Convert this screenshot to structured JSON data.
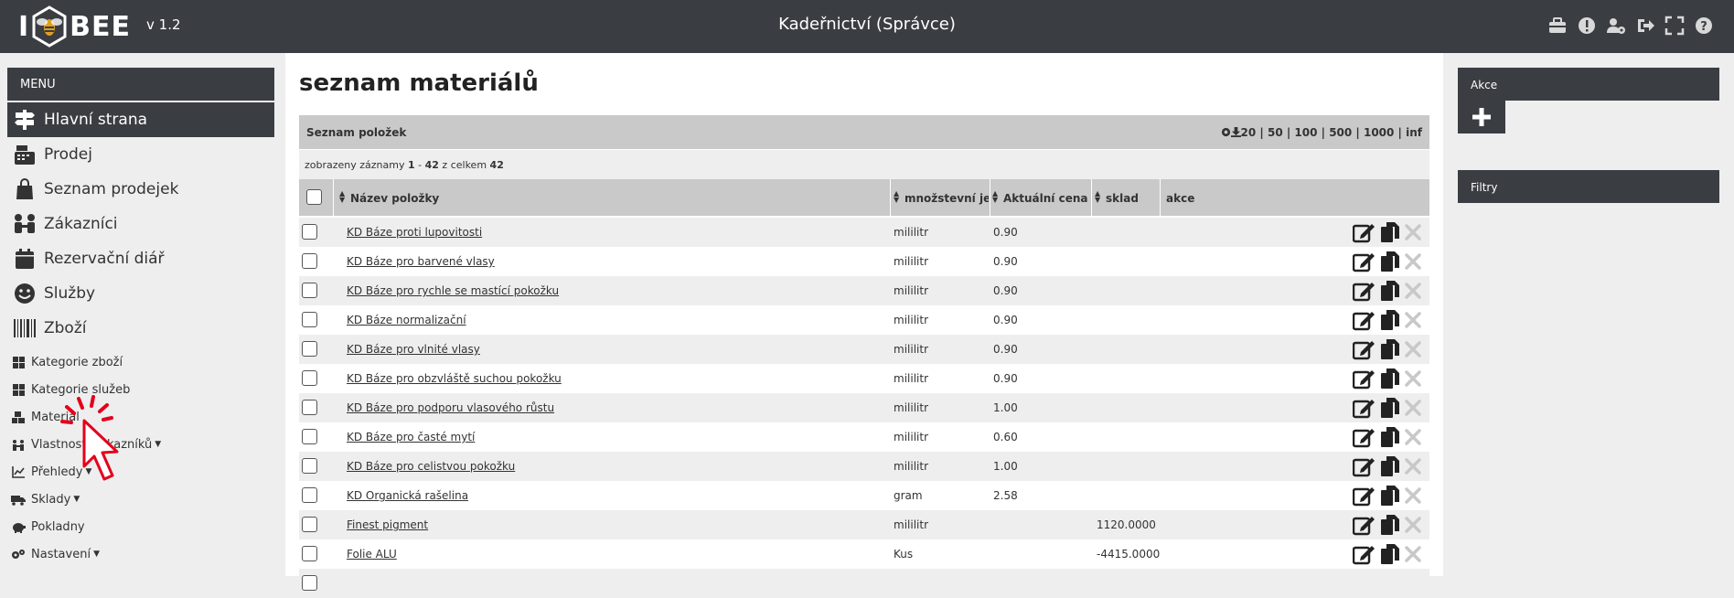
{
  "header": {
    "logo_text_left": "I",
    "logo_text_right": "BEE",
    "version": "v 1.2",
    "title": "Kadeřnictví (Správce)",
    "icons": [
      "briefcase-icon",
      "alert-icon",
      "user-gear-icon",
      "logout-icon",
      "fullscreen-icon",
      "help-icon"
    ]
  },
  "sidebar": {
    "menu_label": "MENU",
    "main_items": [
      {
        "label": "Hlavní strana",
        "icon": "signpost-icon"
      },
      {
        "label": "Prodej",
        "icon": "cash-register-icon"
      },
      {
        "label": "Seznam prodejek",
        "icon": "shopping-bag-icon"
      },
      {
        "label": "Zákazníci",
        "icon": "people-icon"
      },
      {
        "label": "Rezervační diář",
        "icon": "calendar-icon"
      },
      {
        "label": "Služby",
        "icon": "smile-icon"
      },
      {
        "label": "Zboží",
        "icon": "barcode-icon"
      }
    ],
    "sub_items": [
      {
        "label": "Kategorie zboží",
        "icon": "grid-icon"
      },
      {
        "label": "Kategorie služeb",
        "icon": "grid-icon"
      },
      {
        "label": "Materiál",
        "icon": "boxes-icon"
      },
      {
        "label": "Vlastnosti zákazníků",
        "icon": "people-icon"
      },
      {
        "label": "Přehledy",
        "icon": "chart-icon"
      },
      {
        "label": "Sklady",
        "icon": "truck-icon"
      },
      {
        "label": "Pokladny",
        "icon": "piggy-bank-icon"
      },
      {
        "label": "Nastavení",
        "icon": "gears-icon"
      }
    ]
  },
  "main": {
    "title": "seznam materiálů",
    "panel_title": "Seznam položek",
    "page_sizes": "20 | 50 | 100 | 500 | 1000 | inf",
    "records_prefix": "zobrazeny záznamy ",
    "records_from": "1",
    "records_sep": " - ",
    "records_to": "42",
    "records_mid": " z celkem ",
    "records_total": "42",
    "columns": {
      "name": "Název položky",
      "unit": "množstevní jednotk",
      "price": "Aktuální cena",
      "stock": "sklad",
      "actions": "akce"
    },
    "rows": [
      {
        "name": "KD Báze proti lupovitosti",
        "unit": "mililitr",
        "price": "0.90",
        "stock": ""
      },
      {
        "name": "KD Báze pro barvené vlasy",
        "unit": "mililitr",
        "price": "0.90",
        "stock": ""
      },
      {
        "name": "KD Báze pro rychle se mastící pokožku",
        "unit": "mililitr",
        "price": "0.90",
        "stock": ""
      },
      {
        "name": "KD Báze normalizační",
        "unit": "mililitr",
        "price": "0.90",
        "stock": ""
      },
      {
        "name": "KD Báze pro vlnité vlasy",
        "unit": "mililitr",
        "price": "0.90",
        "stock": ""
      },
      {
        "name": "KD Báze pro obzvláště suchou pokožku",
        "unit": "mililitr",
        "price": "0.90",
        "stock": ""
      },
      {
        "name": "KD Báze pro podporu vlasového růstu",
        "unit": "mililitr",
        "price": "1.00",
        "stock": ""
      },
      {
        "name": "KD Báze pro časté mytí",
        "unit": "mililitr",
        "price": "0.60",
        "stock": ""
      },
      {
        "name": "KD Báze pro celistvou pokožku",
        "unit": "mililitr",
        "price": "1.00",
        "stock": ""
      },
      {
        "name": "KD Organická rašelina",
        "unit": "gram",
        "price": "2.58",
        "stock": ""
      },
      {
        "name": "Finest pigment",
        "unit": "mililitr",
        "price": "",
        "stock": "1120.0000"
      },
      {
        "name": "Folie ALU",
        "unit": "Kus",
        "price": "",
        "stock": "-4415.0000"
      }
    ]
  },
  "right": {
    "actions_title": "Akce",
    "filters_title": "Filtry"
  }
}
